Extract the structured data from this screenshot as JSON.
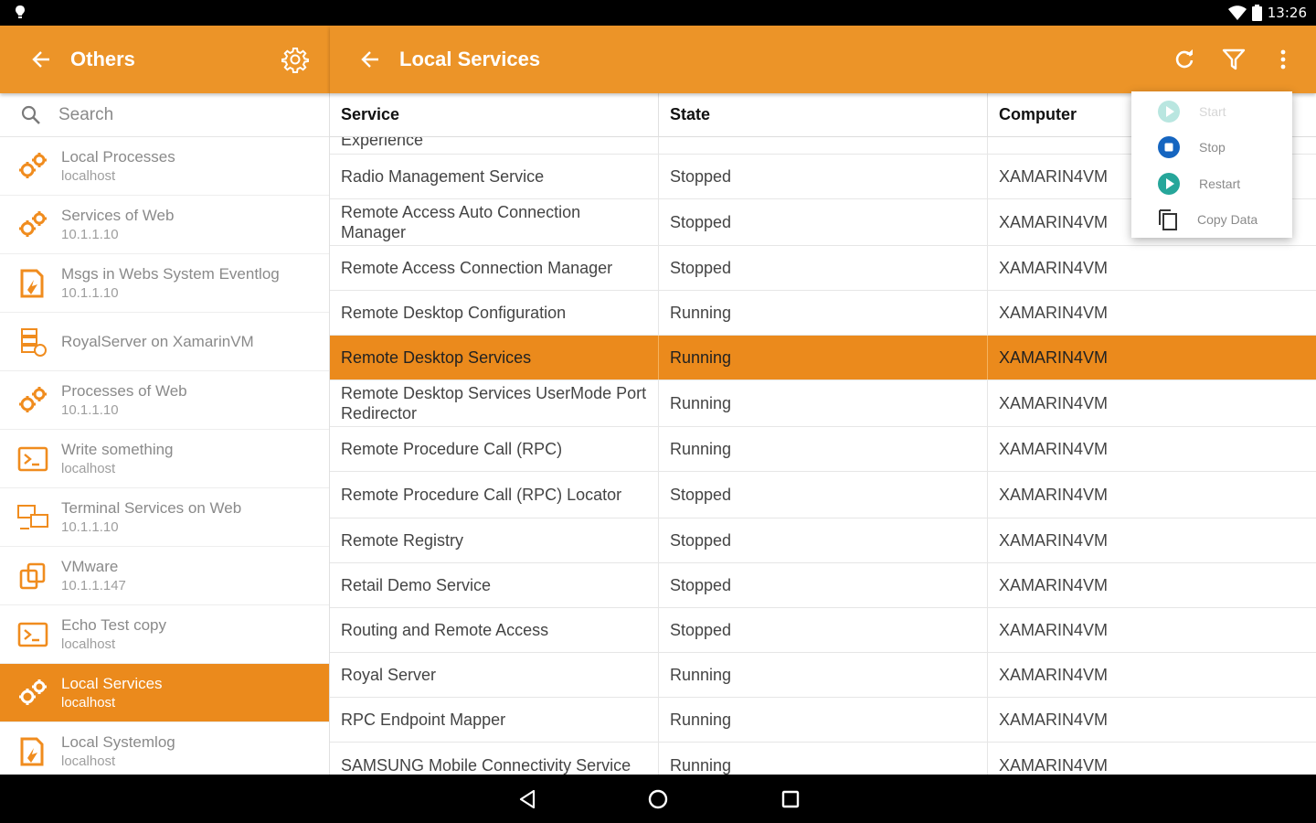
{
  "status_bar": {
    "time": "13:26"
  },
  "left_panel": {
    "title": "Others"
  },
  "right_panel": {
    "title": "Local Services"
  },
  "search": {
    "placeholder": "Search"
  },
  "sidebar": {
    "items": [
      {
        "title": "Local Processes",
        "subtitle": "localhost",
        "icon": "gears-icon"
      },
      {
        "title": "Services of Web",
        "subtitle": "10.1.1.10",
        "icon": "gears-icon"
      },
      {
        "title": "Msgs in Webs System Eventlog",
        "subtitle": "10.1.1.10",
        "icon": "eventlog-icon"
      },
      {
        "title": "RoyalServer on XamarinVM",
        "subtitle": "",
        "icon": "server-icon"
      },
      {
        "title": "Processes of Web",
        "subtitle": "10.1.1.10",
        "icon": "gears-icon"
      },
      {
        "title": "Write something",
        "subtitle": "localhost",
        "icon": "terminal-icon"
      },
      {
        "title": "Terminal Services on Web",
        "subtitle": "10.1.1.10",
        "icon": "terminal-services-icon"
      },
      {
        "title": "VMware",
        "subtitle": "10.1.1.147",
        "icon": "vmware-icon"
      },
      {
        "title": "Echo Test copy",
        "subtitle": "localhost",
        "icon": "terminal-icon"
      },
      {
        "title": "Local Services",
        "subtitle": "localhost",
        "icon": "gears-icon",
        "selected": true
      },
      {
        "title": "Local Systemlog",
        "subtitle": "localhost",
        "icon": "eventlog-icon"
      }
    ]
  },
  "table": {
    "headers": {
      "service": "Service",
      "state": "State",
      "computer": "Computer"
    },
    "partial_row": {
      "service": "Experience",
      "state": "",
      "computer": ""
    },
    "rows": [
      {
        "service": "Radio Management Service",
        "state": "Stopped",
        "computer": "XAMARIN4VM"
      },
      {
        "service": "Remote Access Auto Connection Manager",
        "state": "Stopped",
        "computer": "XAMARIN4VM"
      },
      {
        "service": "Remote Access Connection Manager",
        "state": "Stopped",
        "computer": "XAMARIN4VM"
      },
      {
        "service": "Remote Desktop Configuration",
        "state": "Running",
        "computer": "XAMARIN4VM"
      },
      {
        "service": "Remote Desktop Services",
        "state": "Running",
        "computer": "XAMARIN4VM",
        "selected": true
      },
      {
        "service": "Remote Desktop Services UserMode Port Redirector",
        "state": "Running",
        "computer": "XAMARIN4VM"
      },
      {
        "service": "Remote Procedure Call (RPC)",
        "state": "Running",
        "computer": "XAMARIN4VM"
      },
      {
        "service": "Remote Procedure Call (RPC) Locator",
        "state": "Stopped",
        "computer": "XAMARIN4VM"
      },
      {
        "service": "Remote Registry",
        "state": "Stopped",
        "computer": "XAMARIN4VM"
      },
      {
        "service": "Retail Demo Service",
        "state": "Stopped",
        "computer": "XAMARIN4VM"
      },
      {
        "service": "Routing and Remote Access",
        "state": "Stopped",
        "computer": "XAMARIN4VM"
      },
      {
        "service": "Royal Server",
        "state": "Running",
        "computer": "XAMARIN4VM"
      },
      {
        "service": "RPC Endpoint Mapper",
        "state": "Running",
        "computer": "XAMARIN4VM"
      },
      {
        "service": "SAMSUNG Mobile Connectivity Service",
        "state": "Running",
        "computer": "XAMARIN4VM"
      }
    ]
  },
  "popup_menu": {
    "items": [
      {
        "label": "Start",
        "icon": "play-circle-icon",
        "disabled": true
      },
      {
        "label": "Stop",
        "icon": "stop-circle-icon",
        "disabled": false
      },
      {
        "label": "Restart",
        "icon": "play-circle-icon",
        "disabled": false
      },
      {
        "label": "Copy Data",
        "icon": "copy-icon",
        "disabled": false
      }
    ]
  },
  "colors": {
    "accent": "#EC9428",
    "selected": "#EB8A1C",
    "icon_orange": "#F08C1E",
    "stop_blue": "#1565C0",
    "restart_green": "#26A69A"
  }
}
